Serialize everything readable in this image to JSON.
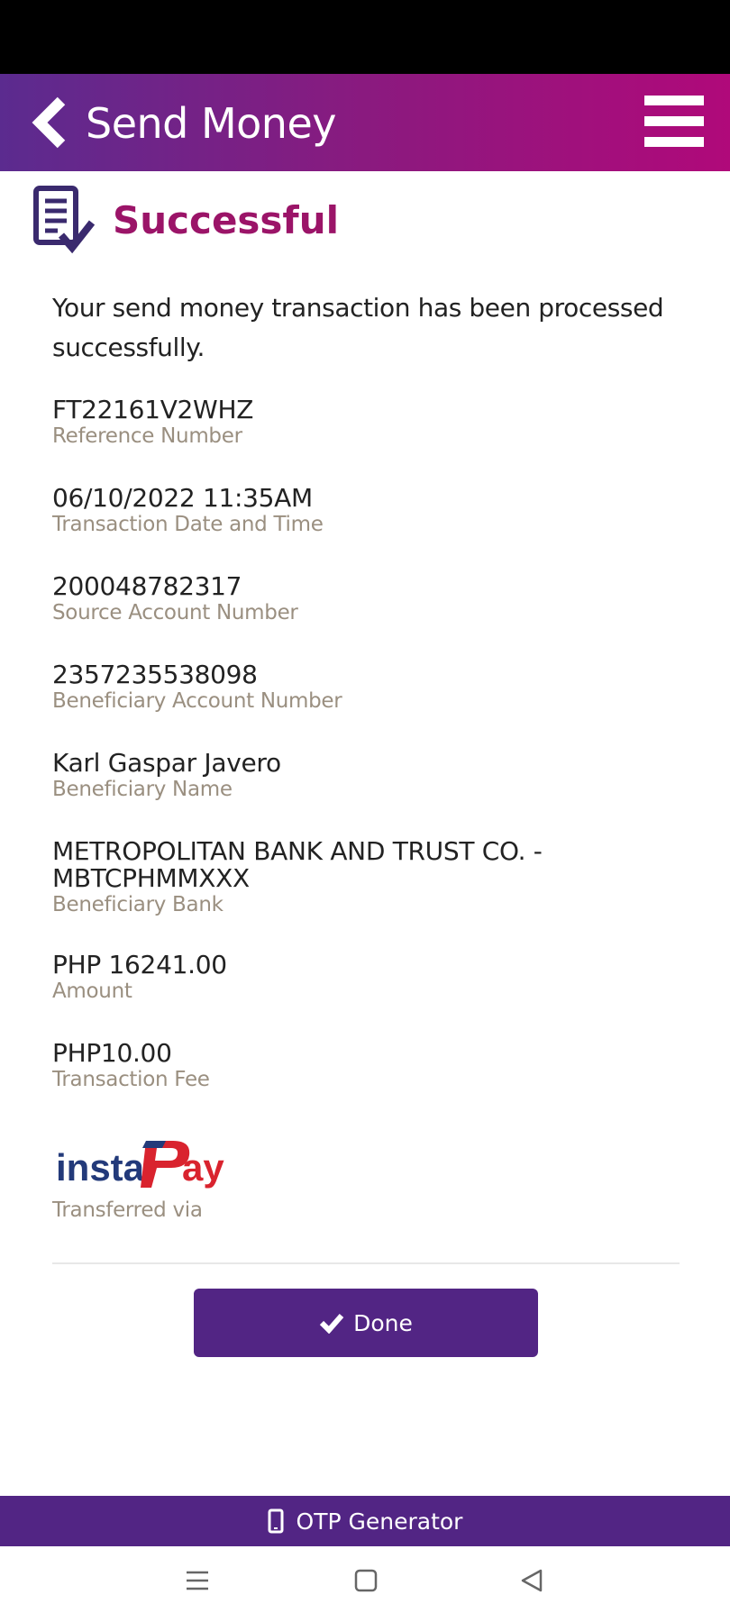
{
  "header": {
    "title": "Send Money",
    "back_icon": "chevron-left-icon",
    "menu_icon": "hamburger-menu-icon",
    "gradient_start": "#5b2b8f",
    "gradient_end": "#b0097a"
  },
  "status": {
    "title": "Successful",
    "icon": "document-check-icon",
    "color": "#9b1468",
    "message": "Your send money transaction has been processed successfully."
  },
  "details": [
    {
      "value": "FT22161V2WHZ",
      "label": "Reference Number"
    },
    {
      "value": "06/10/2022 11:35AM",
      "label": "Transaction Date and Time"
    },
    {
      "value": "200048782317",
      "label": "Source Account Number"
    },
    {
      "value": "2357235538098",
      "label": "Beneficiary Account Number"
    },
    {
      "value": "Karl Gaspar Javero",
      "label": "Beneficiary Name"
    },
    {
      "value": "METROPOLITAN BANK AND TRUST CO. - MBTCPHMMXXX",
      "label": "Beneficiary Bank"
    },
    {
      "value": "PHP 16241.00",
      "label": "Amount"
    },
    {
      "value": "PHP10.00",
      "label": "Transaction Fee"
    }
  ],
  "transfer": {
    "logo_text_a": "insta",
    "logo_text_b": "Pay",
    "label": "Transferred via"
  },
  "actions": {
    "done_label": "Done",
    "done_color": "#522584"
  },
  "footer": {
    "otp_label": "OTP Generator",
    "otp_icon": "phone-icon"
  }
}
